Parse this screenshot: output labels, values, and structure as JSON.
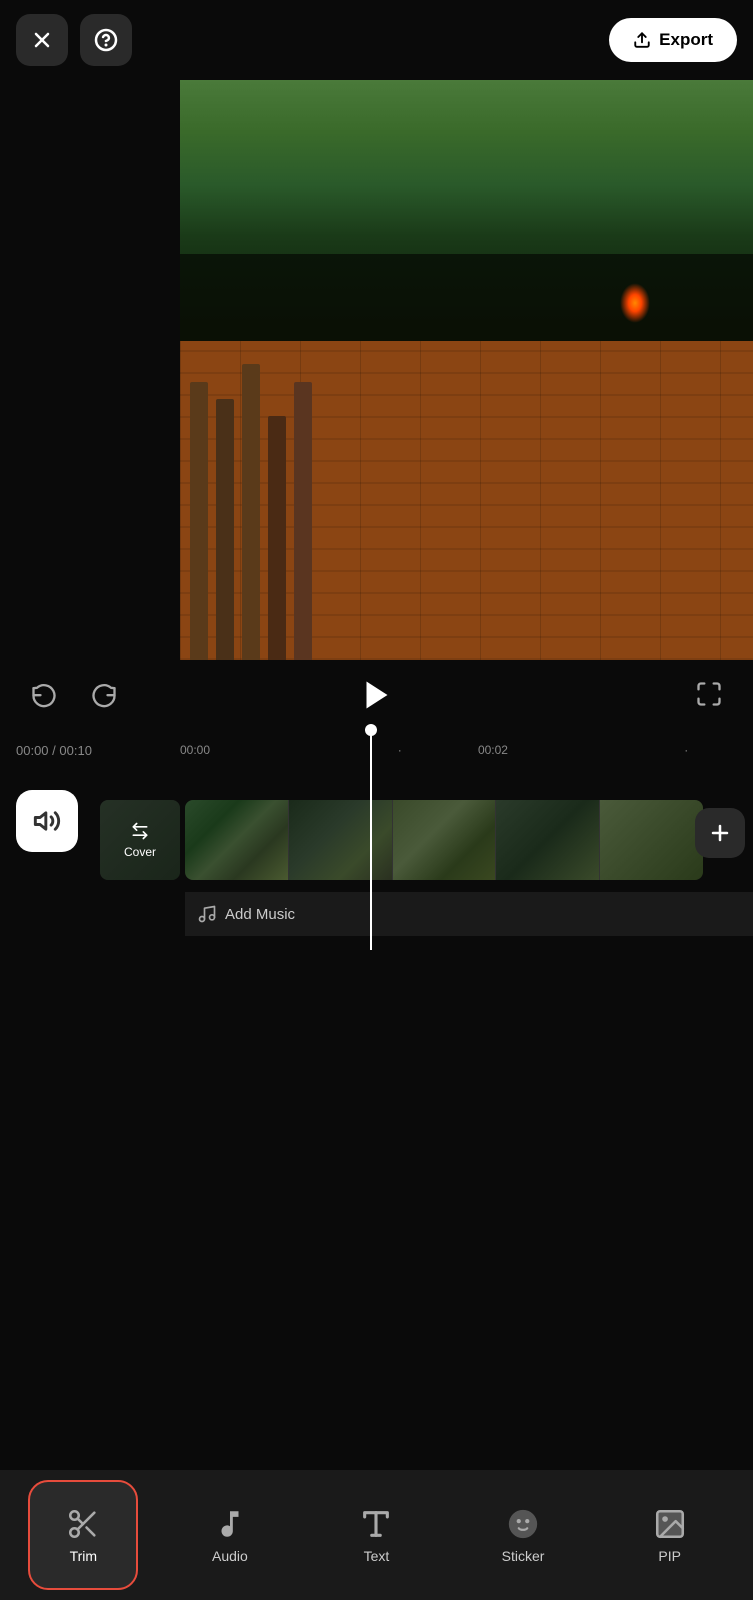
{
  "header": {
    "close_label": "×",
    "help_label": "?",
    "export_label": "Export"
  },
  "playback": {
    "current_time": "00:00",
    "total_time": "00:10",
    "marker1": "00:00",
    "marker2": "00:02"
  },
  "timeline": {
    "cover_label": "Cover",
    "add_music_label": "Add Music"
  },
  "toolbar": {
    "items": [
      {
        "id": "trim",
        "label": "Trim",
        "icon": "scissors",
        "active": true
      },
      {
        "id": "audio",
        "label": "Audio",
        "icon": "music",
        "active": false
      },
      {
        "id": "text",
        "label": "Text",
        "icon": "text",
        "active": false
      },
      {
        "id": "sticker",
        "label": "Sticker",
        "icon": "sticker",
        "active": false
      },
      {
        "id": "pip",
        "label": "PIP",
        "icon": "pip",
        "active": false
      }
    ]
  },
  "colors": {
    "background": "#0a0a0a",
    "active_border": "#e74c3c",
    "accent": "#ffffff"
  }
}
